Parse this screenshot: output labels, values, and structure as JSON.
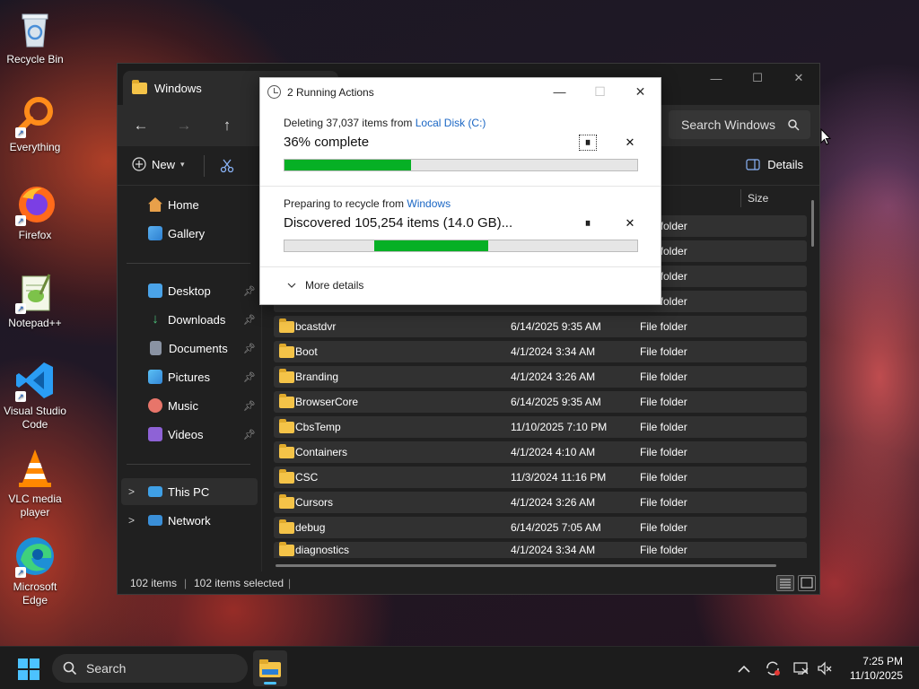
{
  "desktop": {
    "icons": [
      {
        "label": "Recycle Bin",
        "icon": "recycle-bin-icon"
      },
      {
        "label": "Everything",
        "icon": "everything-search-icon"
      },
      {
        "label": "Firefox",
        "icon": "firefox-icon"
      },
      {
        "label": "Notepad++",
        "icon": "notepad-plus-plus-icon"
      },
      {
        "label": "Visual Studio Code",
        "icon": "vscode-icon"
      },
      {
        "label": "VLC media player",
        "icon": "vlc-icon"
      },
      {
        "label": "Microsoft Edge",
        "icon": "edge-icon"
      }
    ]
  },
  "explorer": {
    "tab_title": "Windows",
    "search_placeholder": "Search Windows",
    "new_label": "New",
    "details_label": "Details",
    "columns": {
      "size": "Size"
    },
    "sidebar": {
      "home": "Home",
      "gallery": "Gallery",
      "desktop": "Desktop",
      "downloads": "Downloads",
      "documents": "Documents",
      "pictures": "Pictures",
      "music": "Music",
      "videos": "Videos",
      "this_pc": "This PC",
      "network": "Network"
    },
    "hidden_rows_type": "File folder",
    "rows": [
      {
        "name": "bcastdvr",
        "date": "6/14/2025 9:35 AM",
        "type": "File folder"
      },
      {
        "name": "Boot",
        "date": "4/1/2024 3:34 AM",
        "type": "File folder"
      },
      {
        "name": "Branding",
        "date": "4/1/2024 3:26 AM",
        "type": "File folder"
      },
      {
        "name": "BrowserCore",
        "date": "6/14/2025 9:35 AM",
        "type": "File folder"
      },
      {
        "name": "CbsTemp",
        "date": "11/10/2025 7:10 PM",
        "type": "File folder"
      },
      {
        "name": "Containers",
        "date": "4/1/2024 4:10 AM",
        "type": "File folder"
      },
      {
        "name": "CSC",
        "date": "11/3/2024 11:16 PM",
        "type": "File folder"
      },
      {
        "name": "Cursors",
        "date": "4/1/2024 3:26 AM",
        "type": "File folder"
      },
      {
        "name": "debug",
        "date": "6/14/2025 7:05 AM",
        "type": "File folder"
      },
      {
        "name": "diagnostics",
        "date": "4/1/2024 3:34 AM",
        "type": "File folder"
      }
    ],
    "status": {
      "items": "102 items",
      "selected": "102 items selected"
    }
  },
  "dialog": {
    "title": "2 Running Actions",
    "op1": {
      "line1_prefix": "Deleting 37,037 items from ",
      "line1_link": "Local Disk (C:)",
      "line2": "36% complete",
      "progress_pct": 36
    },
    "op2": {
      "line1_prefix": "Preparing to recycle from ",
      "line1_link": "Windows",
      "line2": "Discovered 105,254 items (14.0 GB)...",
      "indeterminate_segment": [
        0.255,
        0.577
      ]
    },
    "more_details": "More details"
  },
  "taskbar": {
    "search_label": "Search",
    "time": "7:25 PM",
    "date": "11/10/2025"
  },
  "colors": {
    "progress_green": "#06b025",
    "link_blue": "#1a66c4",
    "accent": "#4cc2ff"
  }
}
